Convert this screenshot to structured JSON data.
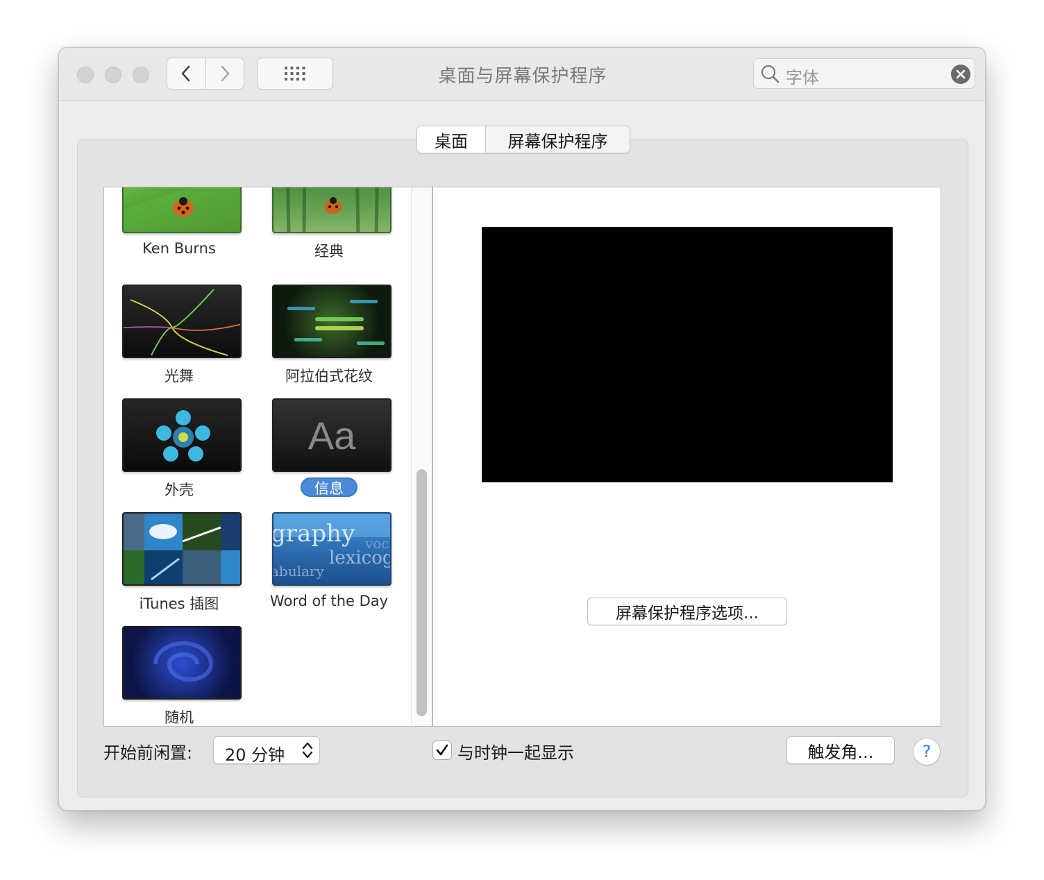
{
  "window": {
    "title": "桌面与屏幕保护程序",
    "search": {
      "value": "字体"
    }
  },
  "tabs": [
    {
      "label": "桌面",
      "active": true
    },
    {
      "label": "屏幕保护程序",
      "active": false
    }
  ],
  "savers": [
    {
      "label": "Ken Burns",
      "selected": false,
      "icon": "ladybug-leaf"
    },
    {
      "label": "经典",
      "selected": false,
      "icon": "ladybug-forest"
    },
    {
      "label": "光舞",
      "selected": false,
      "icon": "light-streaks"
    },
    {
      "label": "阿拉伯式花纹",
      "selected": false,
      "icon": "color-burst"
    },
    {
      "label": "外壳",
      "selected": false,
      "icon": "shell-flower"
    },
    {
      "label": "信息",
      "selected": true,
      "icon": "message-aa",
      "thumb_text": "Aa"
    },
    {
      "label": "iTunes 插图",
      "selected": false,
      "icon": "album-grid"
    },
    {
      "label": "Word of the Day",
      "selected": false,
      "icon": "words"
    },
    {
      "label": "随机",
      "selected": false,
      "icon": "random-swirl"
    }
  ],
  "preview": {
    "options_label": "屏幕保护程序选项..."
  },
  "bottom": {
    "idle_label": "开始前闲置:",
    "idle_value": "20 分钟",
    "clock_label": "与时钟一起显示",
    "clock_checked": true,
    "hot_corners_label": "触发角...",
    "help_label": "?"
  },
  "colors": {
    "selection": "#4a8ad8",
    "help_accent": "#2d7ef0"
  }
}
